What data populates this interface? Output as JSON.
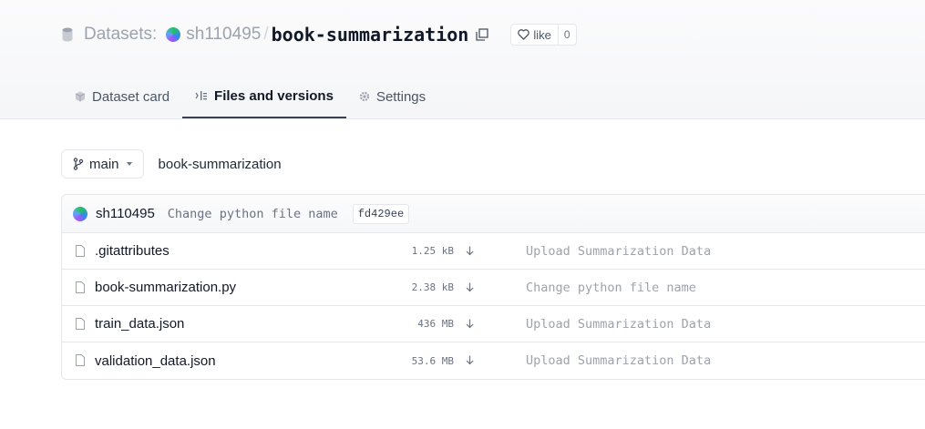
{
  "header": {
    "section_label": "Datasets:",
    "owner": "sh110495",
    "separator": "/",
    "repo_name": "book-summarization",
    "like_label": "like",
    "like_count": "0"
  },
  "tabs": [
    {
      "label": "Dataset card",
      "icon": "dataset-card-icon",
      "active": false
    },
    {
      "label": "Files and versions",
      "icon": "files-icon",
      "active": true
    },
    {
      "label": "Settings",
      "icon": "gear-icon",
      "active": false
    }
  ],
  "branch": {
    "name": "main",
    "path": "book-summarization"
  },
  "last_commit": {
    "user": "sh110495",
    "message": "Change python file name",
    "hash": "fd429ee"
  },
  "files": [
    {
      "name": ".gitattributes",
      "size": "1.25 kB",
      "commit": "Upload Summarization Data"
    },
    {
      "name": "book-summarization.py",
      "size": "2.38 kB",
      "commit": "Change python file name"
    },
    {
      "name": "train_data.json",
      "size": "436 MB",
      "commit": "Upload Summarization Data"
    },
    {
      "name": "validation_data.json",
      "size": "53.6 MB",
      "commit": "Upload Summarization Data"
    }
  ],
  "colors": {
    "accent_text": "#111827",
    "muted_text": "#9ca3af",
    "border": "#e5e7eb"
  }
}
